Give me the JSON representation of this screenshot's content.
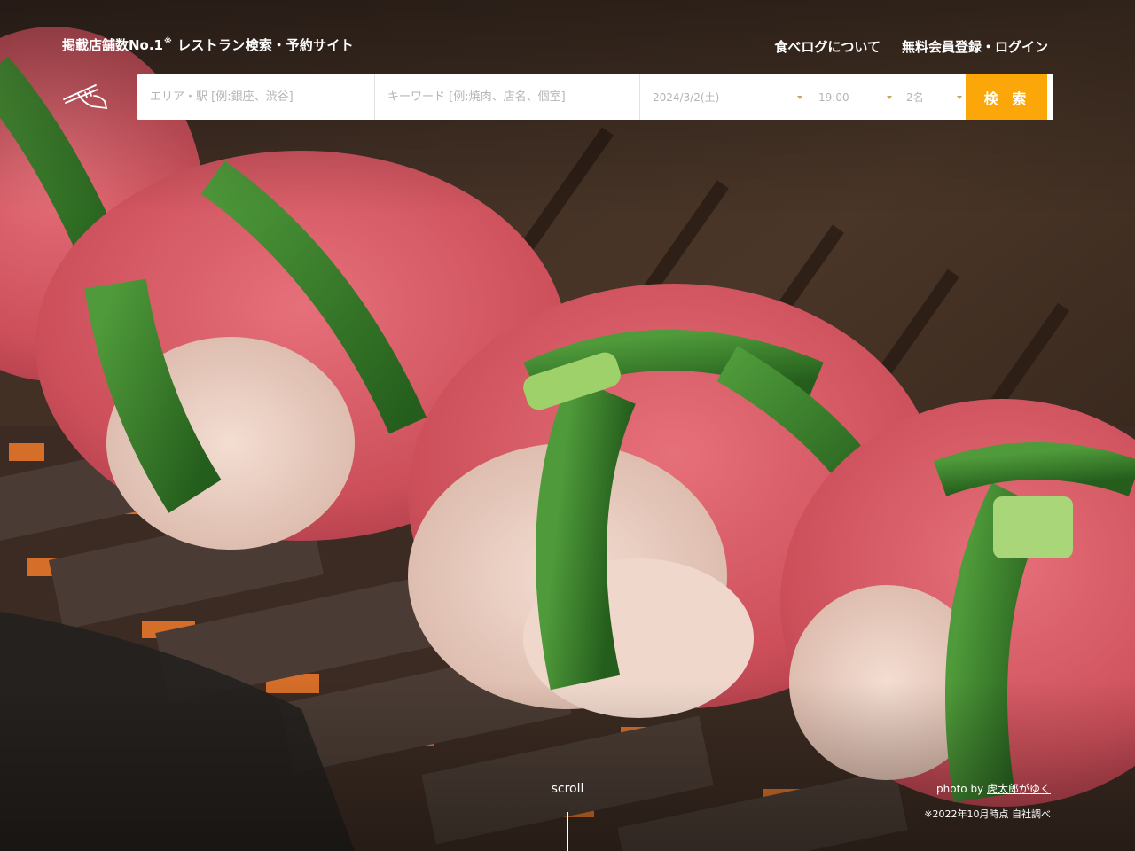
{
  "header": {
    "tagline_brand": "掲載店舗数No.1",
    "tagline_mark": "※",
    "tagline_rest": "レストラン検索・予約サイト",
    "links": [
      "食べログについて",
      "無料会員登録・ログイン"
    ]
  },
  "search": {
    "area_placeholder": "エリア・駅 [例:銀座、渋谷]",
    "keyword_placeholder": "キーワード [例:焼肉、店名、個室]",
    "date_value": "2024/3/2(土)",
    "time_value": "19:00",
    "people_value": "2名",
    "button_label": "検 索"
  },
  "hero": {
    "scroll_label": "scroll",
    "photo_prefix": "photo by ",
    "photo_author": "虎太郎がゆく",
    "footnote": "※2022年10月時点 自社調べ"
  },
  "colors": {
    "search_button": "#fba609"
  },
  "icons": {
    "logo": "chopsticks-logo-icon",
    "dropdown": "caret-down-icon"
  }
}
